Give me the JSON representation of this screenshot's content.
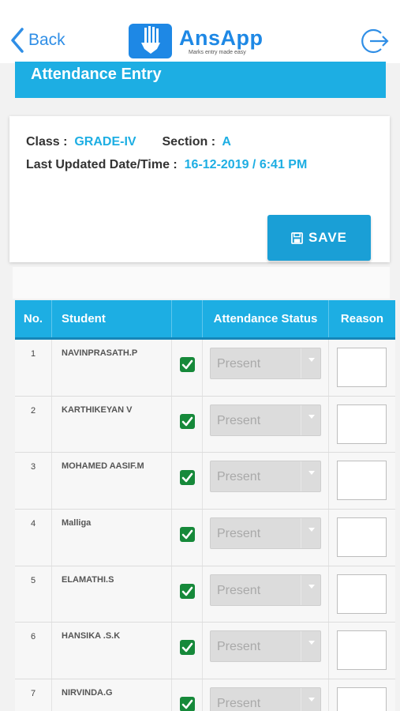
{
  "nav": {
    "back_label": "Back",
    "app_name": "AnsApp",
    "tagline": "Marks entry made easy"
  },
  "page_title": "Attendance Entry",
  "info": {
    "class_label": "Class :",
    "class_value": "GRADE-IV",
    "section_label": "Section :",
    "section_value": "A",
    "updated_label": "Last Updated Date/Time :",
    "updated_value": "16-12-2019 / 6:41 PM"
  },
  "save_label": "SAVE",
  "table": {
    "headers": [
      "No.",
      "Student",
      "",
      "Attendance Status",
      "Reason"
    ],
    "rows": [
      {
        "no": "1",
        "name": "NAVINPRASATH.P",
        "checked": true,
        "status": "Present",
        "reason": ""
      },
      {
        "no": "2",
        "name": "KARTHIKEYAN V",
        "checked": true,
        "status": "Present",
        "reason": ""
      },
      {
        "no": "3",
        "name": "MOHAMED AASIF.M",
        "checked": true,
        "status": "Present",
        "reason": ""
      },
      {
        "no": "4",
        "name": "Malliga",
        "checked": true,
        "status": "Present",
        "reason": ""
      },
      {
        "no": "5",
        "name": "ELAMATHI.S",
        "checked": true,
        "status": "Present",
        "reason": ""
      },
      {
        "no": "6",
        "name": "HANSIKA .S.K",
        "checked": true,
        "status": "Present",
        "reason": ""
      },
      {
        "no": "7",
        "name": "NIRVINDA.G",
        "checked": true,
        "status": "Present",
        "reason": ""
      }
    ]
  },
  "colors": {
    "accent": "#1daee3",
    "link": "#2f8ee6",
    "check": "#16893a"
  },
  "icons": {
    "back": "chevron-left-icon",
    "logout": "logout-icon",
    "save": "floppy-disk-icon",
    "check": "checkbox-checked-icon",
    "dropdown": "dropdown-arrow-icon"
  }
}
